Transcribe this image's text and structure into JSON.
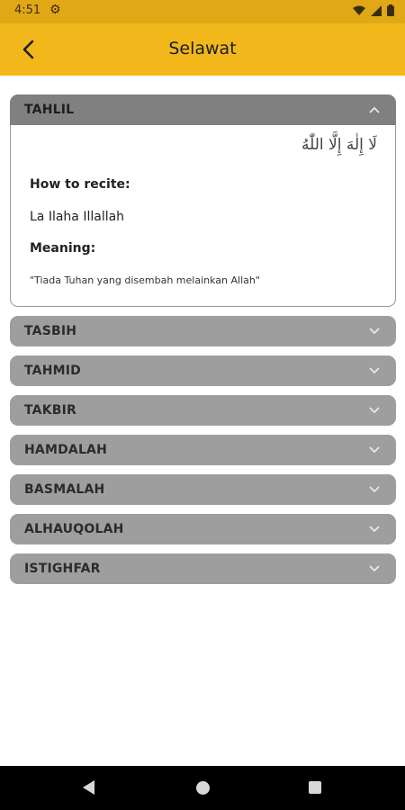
{
  "status_bar": {
    "time": "4:51",
    "gear_icon": "gear-icon"
  },
  "header": {
    "title": "Selawat",
    "back_icon": "arrow-left-icon"
  },
  "accordion": [
    {
      "label": "TAHLIL",
      "expanded": true,
      "arabic": "لَا إِلٰهَ إِلَّا اللّٰهُ",
      "how_label": "How to recite:",
      "recite": "La Ilaha Illallah",
      "meaning_label": "Meaning:",
      "meaning": "\"Tiada Tuhan yang disembah melainkan Allah\""
    },
    {
      "label": "TASBIH",
      "expanded": false
    },
    {
      "label": "TAHMID",
      "expanded": false
    },
    {
      "label": "TAKBIR",
      "expanded": false
    },
    {
      "label": "HAMDALAH",
      "expanded": false
    },
    {
      "label": "BASMALAH",
      "expanded": false
    },
    {
      "label": "ALHAUQOLAH",
      "expanded": false
    },
    {
      "label": "ISTIGHFAR",
      "expanded": false
    }
  ],
  "colors": {
    "app_bar": "#f2b81b",
    "status_bar": "#e0a816",
    "acc_header": "#9e9e9e",
    "acc_header_open": "#808080"
  }
}
